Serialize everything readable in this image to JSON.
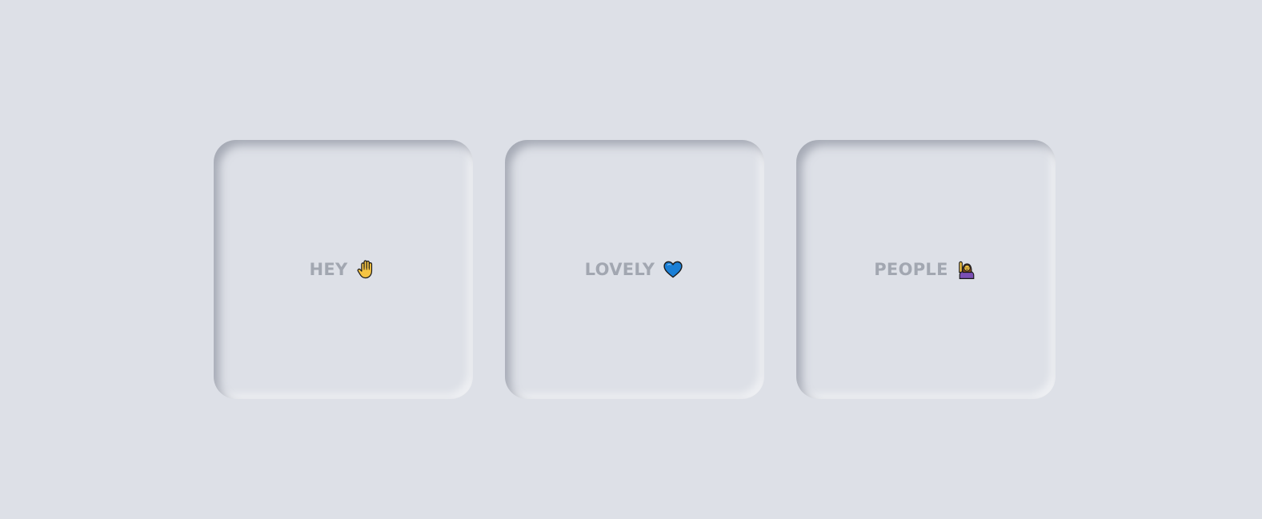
{
  "cards": [
    {
      "text": "HEY",
      "emoji": "raised-hand-icon"
    },
    {
      "text": "LOVELY",
      "emoji": "blue-heart-icon"
    },
    {
      "text": "PEOPLE",
      "emoji": "woman-raising-hand-icon"
    }
  ],
  "colors": {
    "background": "#dde0e7",
    "text": "#a2a7b1",
    "heart": "#1a7fd6",
    "hand": "#f6c544",
    "person_shirt": "#7b4fb5",
    "person_hair": "#8a4d1f"
  }
}
